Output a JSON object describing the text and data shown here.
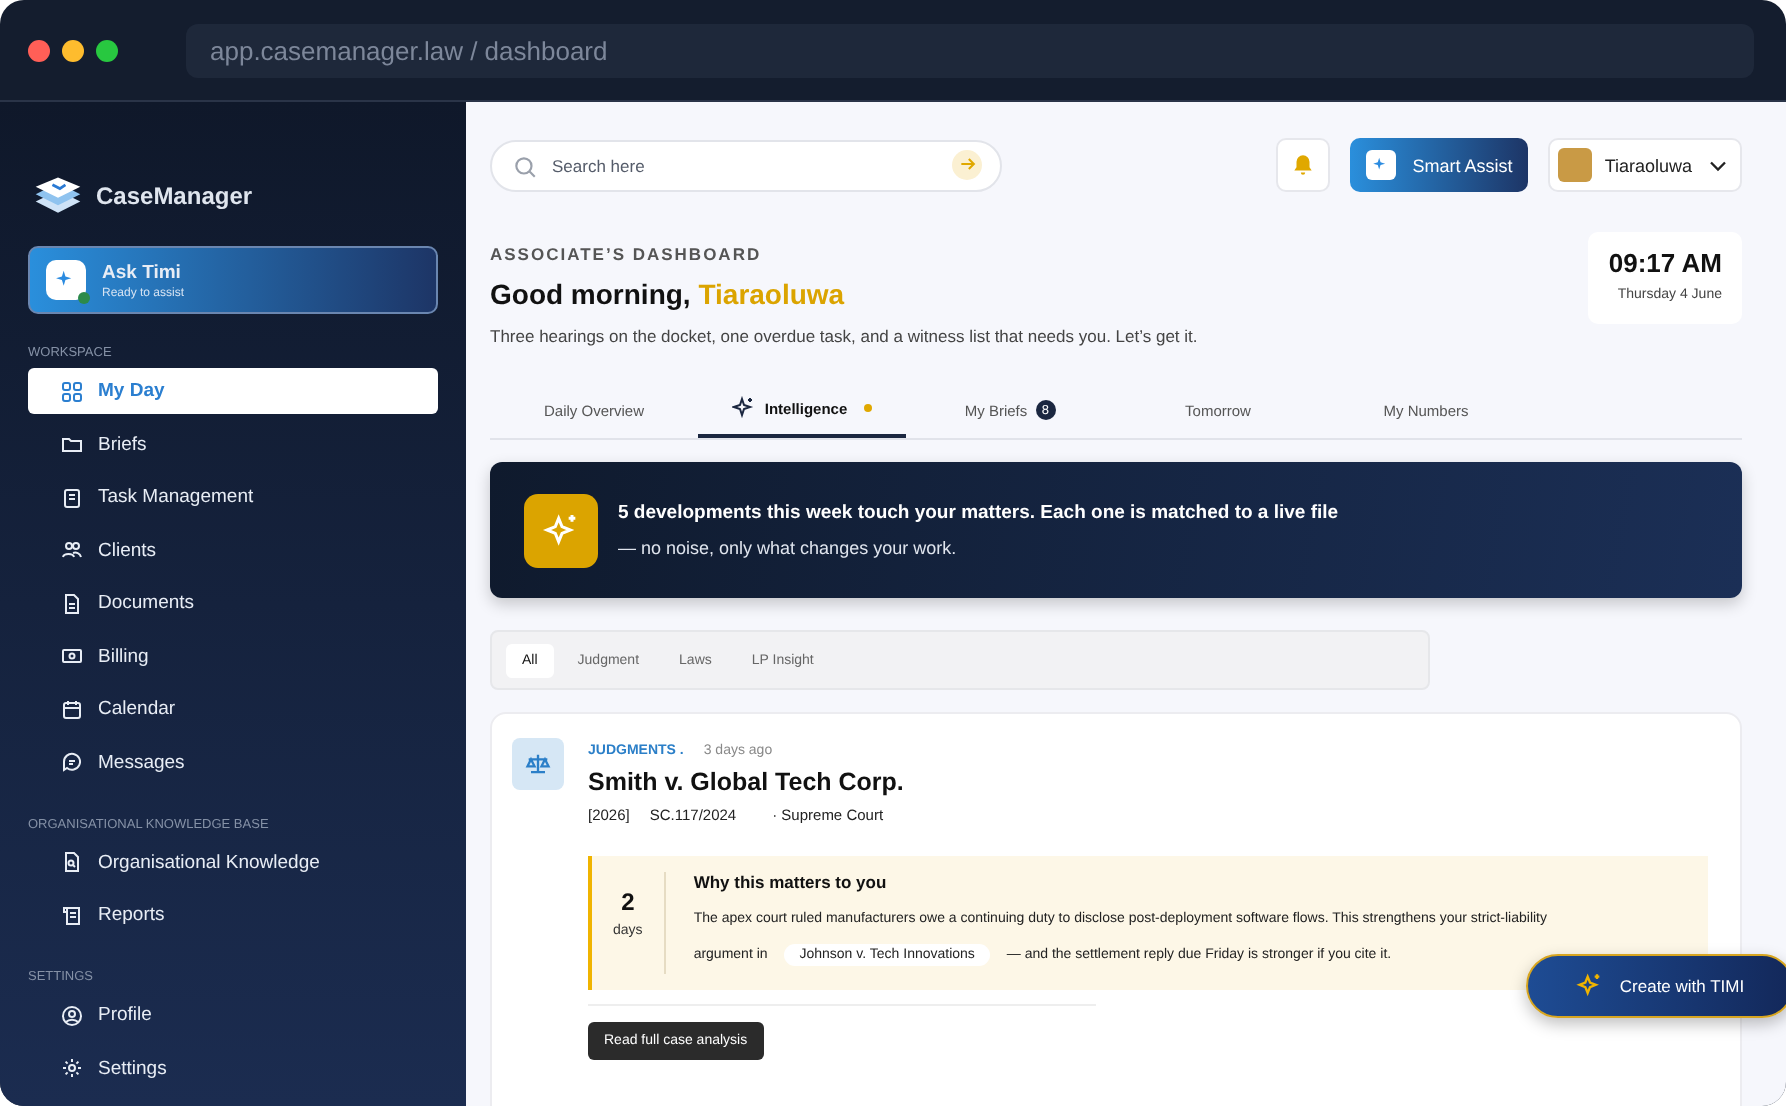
{
  "window": {
    "url": "app.casemanager.law / dashboard"
  },
  "sidebar": {
    "brand": "CaseManager",
    "assistant": {
      "name": "Ask Timi",
      "status": "Ready to assist",
      "online": true
    },
    "sections": [
      {
        "title": "WORKSPACE",
        "items": [
          {
            "label": "My Day",
            "selected": true
          },
          {
            "label": "Briefs",
            "selected": false
          },
          {
            "label": "Task Management",
            "selected": false
          },
          {
            "label": "Clients",
            "selected": false
          },
          {
            "label": "Documents",
            "selected": false
          },
          {
            "label": "Billing",
            "selected": false
          },
          {
            "label": "Calendar",
            "selected": false
          },
          {
            "label": "Messages",
            "selected": false
          }
        ]
      },
      {
        "title": "ORGANISATIONAL KNOWLEDGE BASE",
        "items": [
          {
            "label": "Organisational Knowledge",
            "selected": false
          },
          {
            "label": "Reports",
            "selected": false
          }
        ]
      },
      {
        "title": "SETTINGS",
        "items": [
          {
            "label": "Profile",
            "selected": false
          },
          {
            "label": "Settings",
            "selected": false
          }
        ]
      }
    ]
  },
  "topbar": {
    "search": {
      "placeholder": "Search here"
    },
    "smart_assist": "Smart Assist",
    "user": "Tiaraoluwa"
  },
  "header": {
    "eyebrow": "ASSOCIATE’S DASHBOARD",
    "greeting": "Good morning,",
    "name": "Tiaraoluwa",
    "summary": "Three hearings on the docket, one overdue task, and a witness list that needs you. Let’s get it.",
    "time": "09:17 AM",
    "date": "Thursday 4 June"
  },
  "tabs": [
    {
      "label": "Daily Overview",
      "selected": false
    },
    {
      "label": "Intelligence",
      "selected": true,
      "icon": true,
      "dot": true
    },
    {
      "label": "My Briefs",
      "selected": false,
      "badge": "8"
    },
    {
      "label": "Tomorrow",
      "selected": false
    },
    {
      "label": "My Numbers",
      "selected": false
    }
  ],
  "banner": {
    "headline": "5 developments this week touch your matters. Each one is matched to a live file",
    "subline": "— no noise, only what changes your work."
  },
  "filters": [
    {
      "label": "All",
      "selected": true
    },
    {
      "label": "Judgment",
      "selected": false
    },
    {
      "label": "Laws",
      "selected": false
    },
    {
      "label": "LP Insight",
      "selected": false
    }
  ],
  "item": {
    "category": "JUDGMENTS .",
    "age": "3 days ago",
    "title": "Smith v. Global Tech Corp.",
    "year": "[2026]",
    "citation": "SC.117/2024",
    "court": "· Supreme Court",
    "why": {
      "count": "2",
      "unit": "days",
      "heading": "Why this matters to you",
      "text_before": "The apex court ruled manufacturers owe a continuing duty to disclose post-deployment software flows. This strengthens your strict-liability argument in",
      "link": "Johnson v. Tech Innovations",
      "text_after": "— and the settlement reply due Friday is stronger if you cite it."
    },
    "action": "Read full case analysis"
  },
  "fab": "Create with TIMI"
}
